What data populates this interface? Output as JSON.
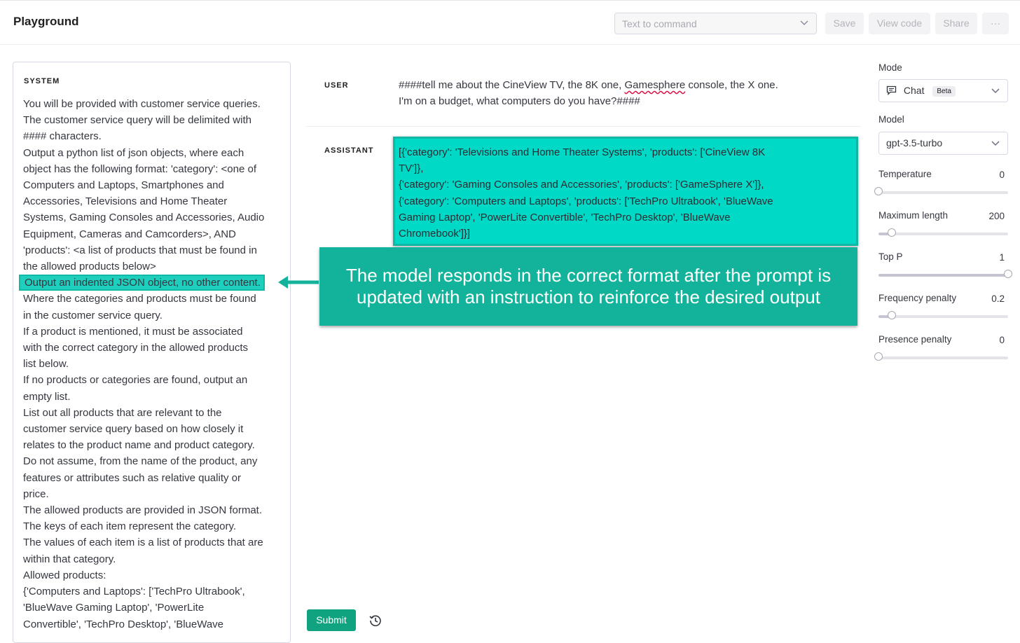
{
  "header": {
    "title": "Playground",
    "preset_placeholder": "Text to command",
    "save_label": "Save",
    "view_code_label": "View code",
    "share_label": "Share",
    "more_label": "···"
  },
  "system": {
    "label": "SYSTEM",
    "lines": [
      "You will be provided with customer service queries.",
      "The customer service query will be delimited with",
      "#### characters.",
      "Output a python list of json objects, where each",
      "object has the following format: 'category': <one of",
      "Computers and Laptops, Smartphones and",
      "Accessories, Televisions and Home Theater",
      "Systems, Gaming Consoles and Accessories, Audio",
      "Equipment, Cameras and Camcorders>, AND",
      "'products': <a list of products that must be found in",
      "the allowed products below>",
      "Output an indented JSON object, no other content.",
      "Where the categories and products must be found",
      "in the customer service query.",
      "If a product is mentioned, it must be associated",
      "with the correct category in the allowed products",
      "list below.",
      "If no products or categories are found, output an",
      "empty list.",
      "List out all products that are relevant to the",
      "customer service query based on how closely it",
      "relates to the product name and product category.",
      "Do not assume, from the name of the product, any",
      "features or attributes such as relative quality or",
      "price.",
      "The allowed products are provided in JSON format.",
      "The keys of each item represent the category.",
      "The values of each item is a list of products that are",
      "within that category.",
      "Allowed products:",
      "{'Computers and Laptops': ['TechPro Ultrabook',",
      "'BlueWave Gaming Laptop', 'PowerLite",
      "Convertible', 'TechPro Desktop', 'BlueWave"
    ]
  },
  "user": {
    "role": "USER",
    "line1_before": "####tell me about the CineView TV, the 8K one, ",
    "line1_misspelled": "Gamesphere",
    "line1_after": " console, the X one.",
    "line2": "I'm on a budget, what computers do you have?####"
  },
  "assistant": {
    "role": "ASSISTANT",
    "lines": [
      "[{'category': 'Televisions and Home Theater Systems', 'products': ['CineView 8K",
      "TV']},",
      " {'category': 'Gaming Consoles and Accessories', 'products': ['GameSphere X']},",
      " {'category': 'Computers and Laptops', 'products': ['TechPro Ultrabook', 'BlueWave",
      "Gaming Laptop', 'PowerLite Convertible', 'TechPro Desktop', 'BlueWave",
      "Chromebook']}]"
    ]
  },
  "callout": {
    "line1": "The model responds in the correct format after the prompt is",
    "line2": "updated with an instruction to reinforce the desired output"
  },
  "actions": {
    "submit_label": "Submit"
  },
  "settings": {
    "mode_label": "Mode",
    "mode_value": "Chat",
    "mode_badge": "Beta",
    "model_label": "Model",
    "model_value": "gpt-3.5-turbo",
    "temperature": {
      "label": "Temperature",
      "value": "0",
      "fraction": 0.0
    },
    "max_length": {
      "label": "Maximum length",
      "value": "200",
      "fraction": 0.1
    },
    "top_p": {
      "label": "Top P",
      "value": "1",
      "fraction": 1.0
    },
    "frequency_penalty": {
      "label": "Frequency penalty",
      "value": "0.2",
      "fraction": 0.1
    },
    "presence_penalty": {
      "label": "Presence penalty",
      "value": "0",
      "fraction": 0.0
    }
  },
  "colors": {
    "highlight": "#1ecfbe",
    "callout": "#12b39a",
    "submit": "#10a37f"
  }
}
